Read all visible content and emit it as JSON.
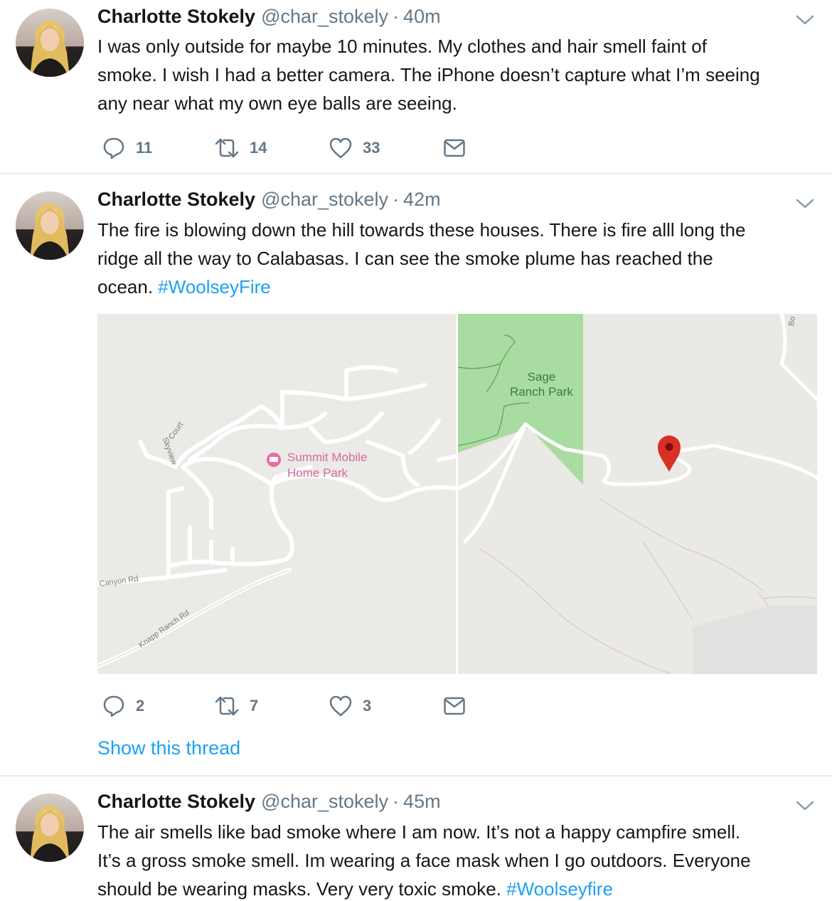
{
  "tweets": [
    {
      "name": "Charlotte Stokely",
      "handle": "@char_stokely",
      "dot": "·",
      "time": "40m",
      "text_lines": [
        "I was only outside for maybe 10 minutes. My clothes and hair smell faint of",
        "smoke. I wish I had a better camera. The iPhone doesn’t capture what I’m seeing",
        "any near what my own eye balls are seeing."
      ],
      "replies": "11",
      "retweets": "14",
      "likes": "33"
    },
    {
      "name": "Charlotte Stokely",
      "handle": "@char_stokely",
      "dot": "·",
      "time": "42m",
      "text_lines": [
        "The fire is blowing down the hill towards these houses. There is fire alll long the",
        "ridge all the way to Calabasas. I can see the smoke plume has reached the",
        "ocean. "
      ],
      "hashtag": "#WoolseyFire",
      "replies": "2",
      "retweets": "7",
      "likes": "3",
      "show_thread": "Show this thread",
      "map": {
        "poi_line1": "Summit Mobile",
        "poi_line2": "Home Park",
        "park_line1": "Sage",
        "park_line2": "Ranch Park",
        "road_canyon": "Canyon Rd",
        "road_knapp": "Knapp Ranch Rd",
        "road_skyview": "Skyview",
        "road_court": "Court",
        "edge_label": "Bo"
      }
    },
    {
      "name": "Charlotte Stokely",
      "handle": "@char_stokely",
      "dot": "·",
      "time": "45m",
      "text_lines": [
        "The air smells like bad smoke where I am now. It’s not a happy campfire smell.",
        "It’s a gross smoke smell. Im wearing a face mask when I go outdoors. Everyone",
        "should be wearing masks. Very very toxic smoke. "
      ],
      "hashtag": "#Woolseyfire"
    }
  ],
  "colors": {
    "text": "#14171a",
    "secondary": "#657786",
    "link": "#1da1f2",
    "divider": "#e6ecf0",
    "park": "#a8dca0",
    "pin": "#d93025"
  },
  "icons": [
    "reply-icon",
    "retweet-icon",
    "like-icon",
    "message-icon",
    "chevron-down-icon",
    "map-pin-icon",
    "hotel-icon"
  ]
}
